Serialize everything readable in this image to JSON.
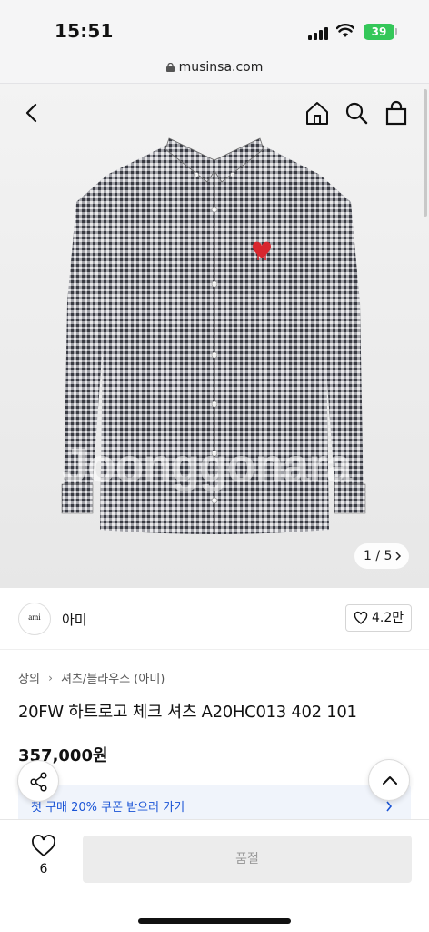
{
  "status_bar": {
    "time": "15:51",
    "battery": "39"
  },
  "browser": {
    "url": "musinsa.com"
  },
  "header": {
    "back_icon": "chevron-left-icon",
    "home_icon": "home-icon",
    "search_icon": "search-icon",
    "cart_icon": "shopping-bag-icon"
  },
  "gallery": {
    "page_indicator": "1 / 5",
    "watermark": "Joonggonara",
    "current_page": 1,
    "total_pages": 5
  },
  "brand": {
    "logo_text": "ami",
    "name": "아미",
    "likes": "4.2만"
  },
  "breadcrumb": {
    "category": "상의",
    "subcategory": "셔츠/블라우스 (아미)"
  },
  "product": {
    "title": "20FW 하트로고 체크 셔츠 A20HC013 402 101",
    "price": "357,000원"
  },
  "coupon": {
    "text": "첫 구매 20% 쿠폰 받으러 가기"
  },
  "bottom_bar": {
    "wish_count": "6",
    "buy_button": "품절"
  },
  "colors": {
    "coupon_blue": "#1a54d6",
    "heart_red": "#d8262e",
    "battery_green": "#34c759"
  }
}
